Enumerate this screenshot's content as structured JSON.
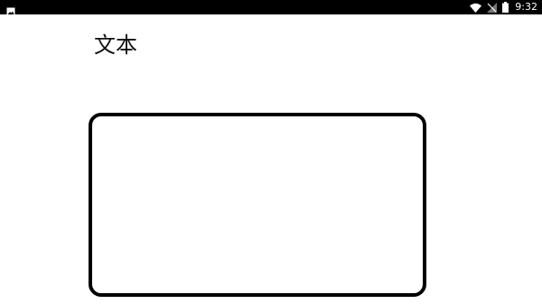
{
  "status_bar": {
    "time": "9:32",
    "icons": {
      "left": "image-notification-icon",
      "wifi": "wifi-icon",
      "signal": "no-signal-icon",
      "battery": "battery-icon"
    },
    "background_color": "#000000",
    "foreground_color": "#ffffff"
  },
  "main": {
    "title": "文本",
    "text_input": {
      "value": "",
      "placeholder": ""
    }
  },
  "colors": {
    "background": "#ffffff",
    "border": "#000000",
    "text": "#111111"
  }
}
